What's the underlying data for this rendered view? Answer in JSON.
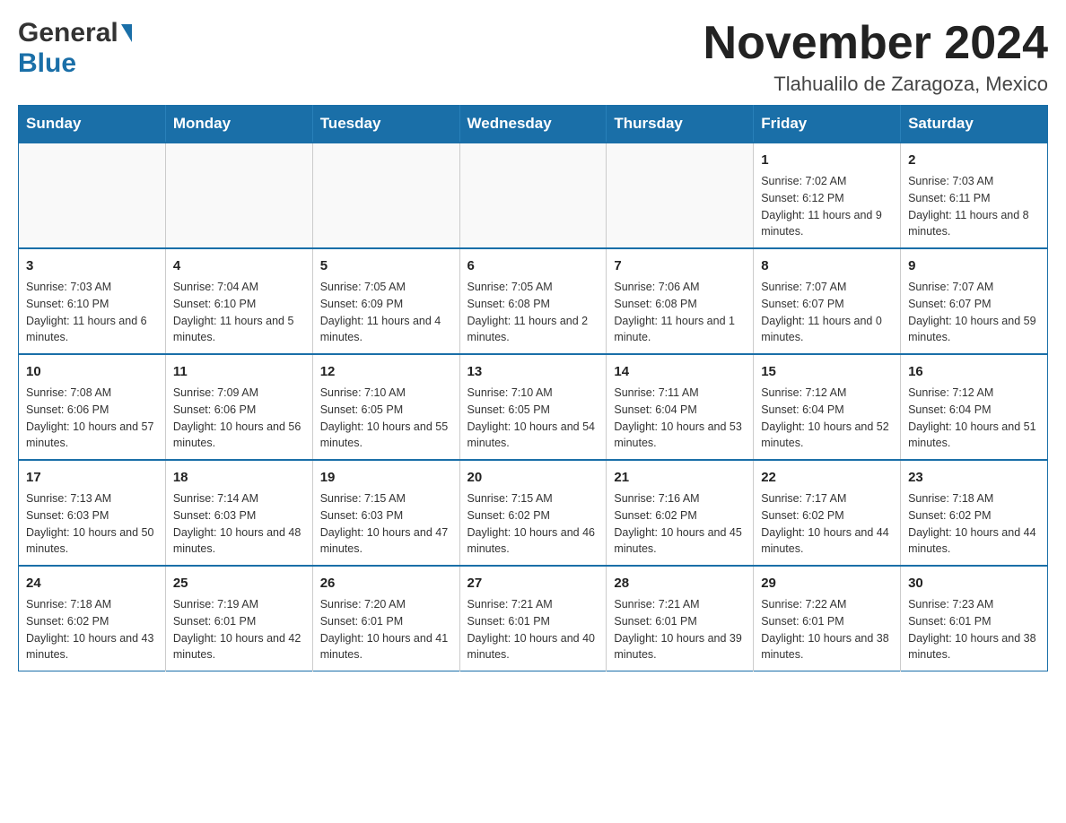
{
  "logo": {
    "general": "General",
    "blue": "Blue"
  },
  "title": {
    "month_year": "November 2024",
    "location": "Tlahualilo de Zaragoza, Mexico"
  },
  "weekdays": [
    "Sunday",
    "Monday",
    "Tuesday",
    "Wednesday",
    "Thursday",
    "Friday",
    "Saturday"
  ],
  "weeks": [
    [
      {
        "day": "",
        "info": ""
      },
      {
        "day": "",
        "info": ""
      },
      {
        "day": "",
        "info": ""
      },
      {
        "day": "",
        "info": ""
      },
      {
        "day": "",
        "info": ""
      },
      {
        "day": "1",
        "info": "Sunrise: 7:02 AM\nSunset: 6:12 PM\nDaylight: 11 hours and 9 minutes."
      },
      {
        "day": "2",
        "info": "Sunrise: 7:03 AM\nSunset: 6:11 PM\nDaylight: 11 hours and 8 minutes."
      }
    ],
    [
      {
        "day": "3",
        "info": "Sunrise: 7:03 AM\nSunset: 6:10 PM\nDaylight: 11 hours and 6 minutes."
      },
      {
        "day": "4",
        "info": "Sunrise: 7:04 AM\nSunset: 6:10 PM\nDaylight: 11 hours and 5 minutes."
      },
      {
        "day": "5",
        "info": "Sunrise: 7:05 AM\nSunset: 6:09 PM\nDaylight: 11 hours and 4 minutes."
      },
      {
        "day": "6",
        "info": "Sunrise: 7:05 AM\nSunset: 6:08 PM\nDaylight: 11 hours and 2 minutes."
      },
      {
        "day": "7",
        "info": "Sunrise: 7:06 AM\nSunset: 6:08 PM\nDaylight: 11 hours and 1 minute."
      },
      {
        "day": "8",
        "info": "Sunrise: 7:07 AM\nSunset: 6:07 PM\nDaylight: 11 hours and 0 minutes."
      },
      {
        "day": "9",
        "info": "Sunrise: 7:07 AM\nSunset: 6:07 PM\nDaylight: 10 hours and 59 minutes."
      }
    ],
    [
      {
        "day": "10",
        "info": "Sunrise: 7:08 AM\nSunset: 6:06 PM\nDaylight: 10 hours and 57 minutes."
      },
      {
        "day": "11",
        "info": "Sunrise: 7:09 AM\nSunset: 6:06 PM\nDaylight: 10 hours and 56 minutes."
      },
      {
        "day": "12",
        "info": "Sunrise: 7:10 AM\nSunset: 6:05 PM\nDaylight: 10 hours and 55 minutes."
      },
      {
        "day": "13",
        "info": "Sunrise: 7:10 AM\nSunset: 6:05 PM\nDaylight: 10 hours and 54 minutes."
      },
      {
        "day": "14",
        "info": "Sunrise: 7:11 AM\nSunset: 6:04 PM\nDaylight: 10 hours and 53 minutes."
      },
      {
        "day": "15",
        "info": "Sunrise: 7:12 AM\nSunset: 6:04 PM\nDaylight: 10 hours and 52 minutes."
      },
      {
        "day": "16",
        "info": "Sunrise: 7:12 AM\nSunset: 6:04 PM\nDaylight: 10 hours and 51 minutes."
      }
    ],
    [
      {
        "day": "17",
        "info": "Sunrise: 7:13 AM\nSunset: 6:03 PM\nDaylight: 10 hours and 50 minutes."
      },
      {
        "day": "18",
        "info": "Sunrise: 7:14 AM\nSunset: 6:03 PM\nDaylight: 10 hours and 48 minutes."
      },
      {
        "day": "19",
        "info": "Sunrise: 7:15 AM\nSunset: 6:03 PM\nDaylight: 10 hours and 47 minutes."
      },
      {
        "day": "20",
        "info": "Sunrise: 7:15 AM\nSunset: 6:02 PM\nDaylight: 10 hours and 46 minutes."
      },
      {
        "day": "21",
        "info": "Sunrise: 7:16 AM\nSunset: 6:02 PM\nDaylight: 10 hours and 45 minutes."
      },
      {
        "day": "22",
        "info": "Sunrise: 7:17 AM\nSunset: 6:02 PM\nDaylight: 10 hours and 44 minutes."
      },
      {
        "day": "23",
        "info": "Sunrise: 7:18 AM\nSunset: 6:02 PM\nDaylight: 10 hours and 44 minutes."
      }
    ],
    [
      {
        "day": "24",
        "info": "Sunrise: 7:18 AM\nSunset: 6:02 PM\nDaylight: 10 hours and 43 minutes."
      },
      {
        "day": "25",
        "info": "Sunrise: 7:19 AM\nSunset: 6:01 PM\nDaylight: 10 hours and 42 minutes."
      },
      {
        "day": "26",
        "info": "Sunrise: 7:20 AM\nSunset: 6:01 PM\nDaylight: 10 hours and 41 minutes."
      },
      {
        "day": "27",
        "info": "Sunrise: 7:21 AM\nSunset: 6:01 PM\nDaylight: 10 hours and 40 minutes."
      },
      {
        "day": "28",
        "info": "Sunrise: 7:21 AM\nSunset: 6:01 PM\nDaylight: 10 hours and 39 minutes."
      },
      {
        "day": "29",
        "info": "Sunrise: 7:22 AM\nSunset: 6:01 PM\nDaylight: 10 hours and 38 minutes."
      },
      {
        "day": "30",
        "info": "Sunrise: 7:23 AM\nSunset: 6:01 PM\nDaylight: 10 hours and 38 minutes."
      }
    ]
  ]
}
